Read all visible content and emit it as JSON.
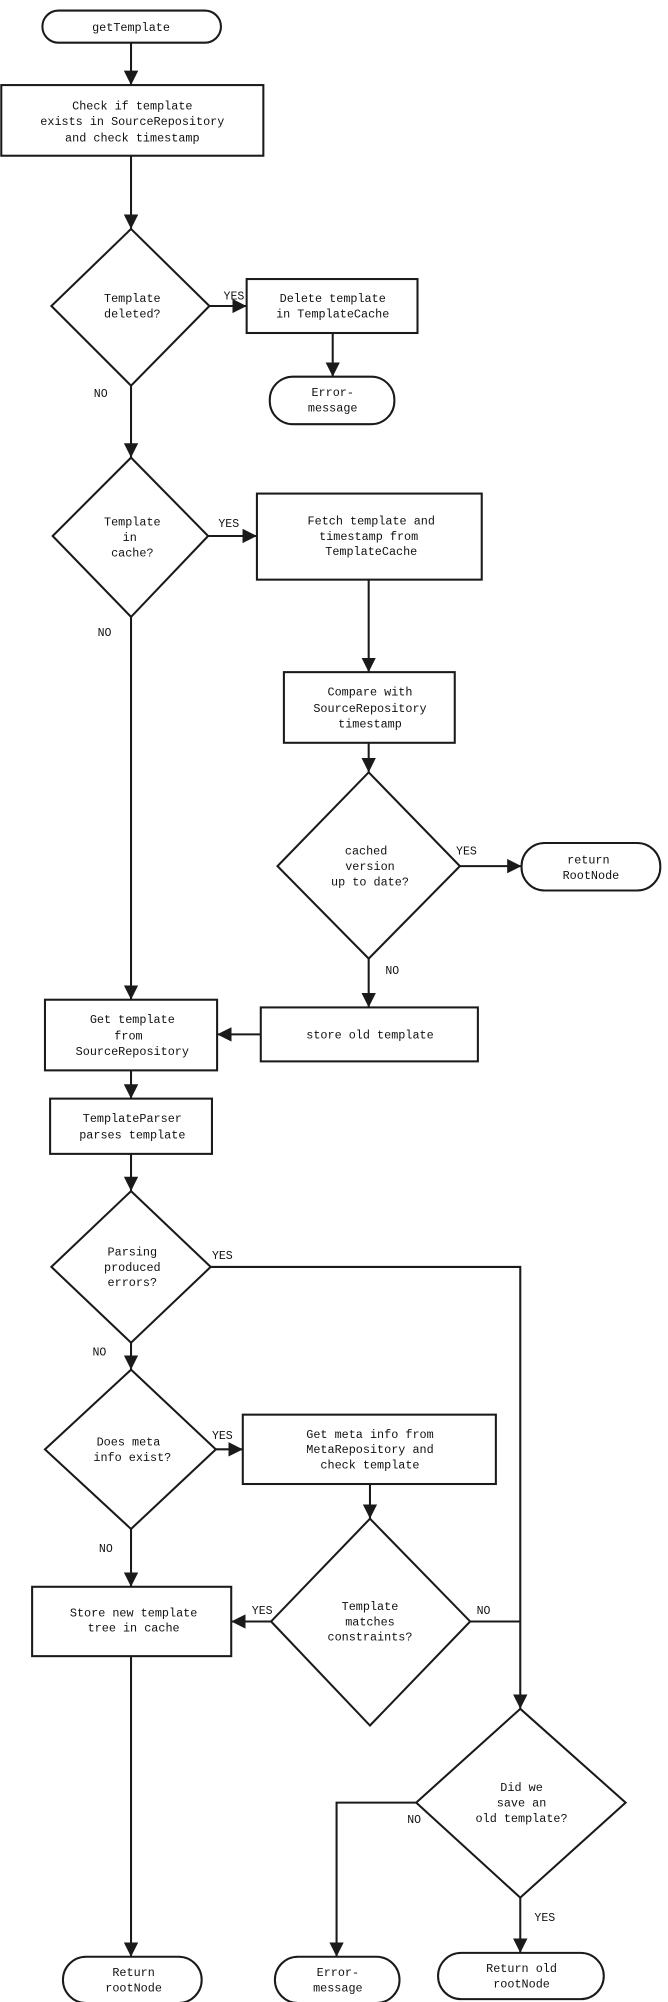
{
  "diagram": {
    "type": "flowchart",
    "nodes": {
      "start": [
        "getTemplate"
      ],
      "check_exists": [
        "Check if template",
        "exists in SourceRepository",
        "and check timestamp"
      ],
      "dec_deleted": [
        "Template",
        "deleted?"
      ],
      "delete_cache": [
        "Delete template",
        "in TemplateCache"
      ],
      "error1": [
        "Error-",
        "message"
      ],
      "dec_in_cache": [
        "Template",
        "in",
        "cache?"
      ],
      "fetch": [
        "Fetch template and",
        "timestamp from",
        "TemplateCache"
      ],
      "compare": [
        "Compare with",
        "SourceRepository",
        "timestamp"
      ],
      "dec_uptodate": [
        "cached",
        "version",
        "up to date?"
      ],
      "return_root": [
        "return",
        "RootNode"
      ],
      "get_source": [
        "Get template",
        "from",
        "SourceRepository"
      ],
      "store_old": [
        "store old template"
      ],
      "parser": [
        "TemplateParser",
        "parses template"
      ],
      "dec_errors": [
        "Parsing",
        "produced",
        "errors?"
      ],
      "dec_meta": [
        "Does meta",
        "info exist?"
      ],
      "get_meta": [
        "Get meta info from",
        "MetaRepository and",
        "check template"
      ],
      "dec_matches": [
        "Template",
        "matches",
        "constraints?"
      ],
      "store_new": [
        "Store new template",
        "tree in cache"
      ],
      "dec_saved_old": [
        "Did we",
        "save an",
        "old template?"
      ],
      "return_rootnode": [
        "Return",
        "rootNode"
      ],
      "error2": [
        "Error-",
        "message"
      ],
      "return_old": [
        "Return old",
        "rootNode"
      ]
    },
    "edge_labels": {
      "yes": "YES",
      "no": "NO"
    }
  }
}
